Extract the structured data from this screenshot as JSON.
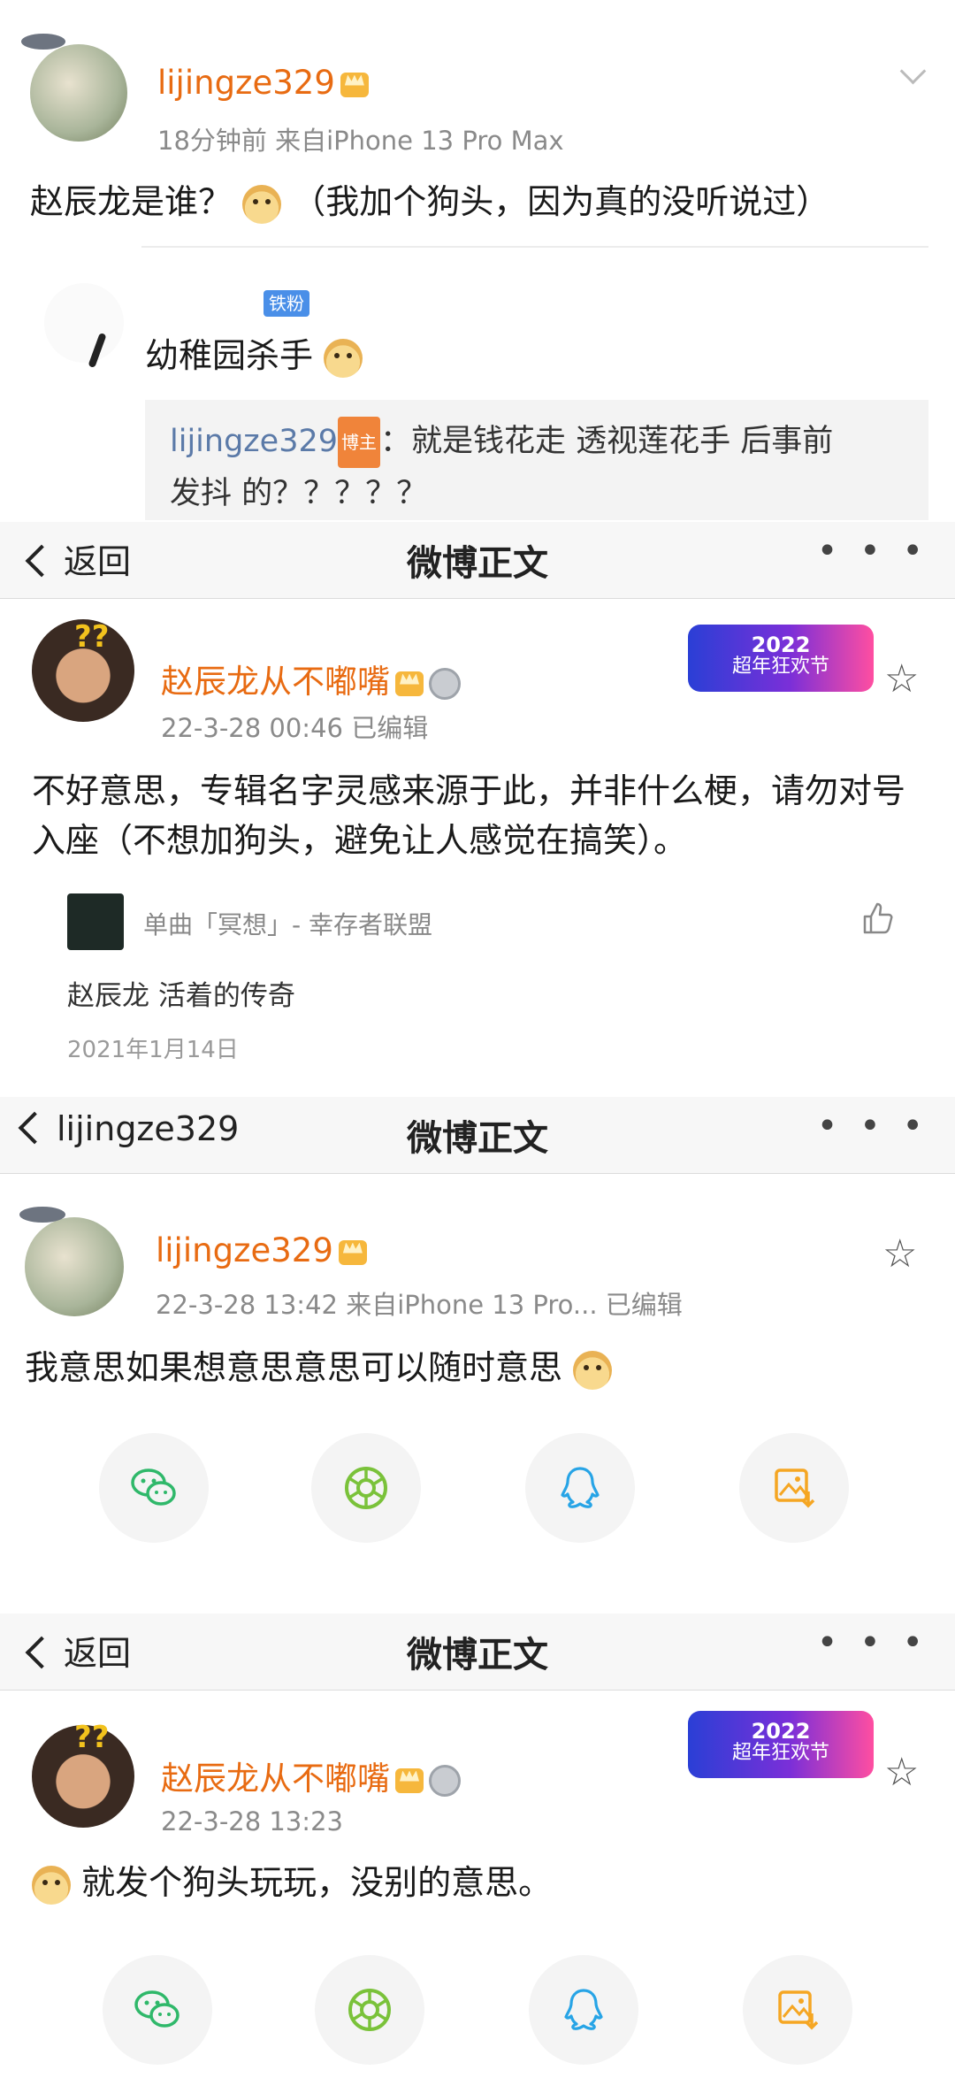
{
  "section1": {
    "username": "lijingze329",
    "meta": "18分钟前  来自iPhone 13 Pro Max",
    "comment": "赵辰龙是谁？",
    "comment_tail": "（我加个狗头，因为真的没听说过）",
    "reply_badge": "铁粉",
    "reply_text": "幼稚园杀手",
    "quote_user": "lijingze329",
    "quote_badge": "博主",
    "quote_line1": "：就是钱花走 透视莲花手 后事前",
    "quote_line2": "发抖 的？？？？？"
  },
  "section2": {
    "back_label": "返回",
    "title": "微博正文",
    "more": "• • •",
    "username": "赵辰龙从不嘟嘴",
    "meta": "22-3-28 00:46   已编辑",
    "badge_year": "2022",
    "badge_text": "超年狂欢节",
    "content": "不好意思，专辑名字灵感来源于此，并非什么梗，请勿对号入座（不想加狗头，避免让人感觉在搞笑）。",
    "music_label": "单曲「冥想」- 幸存者联盟",
    "sub_text": "赵辰龙  活着的传奇",
    "date": "2021年1月14日"
  },
  "section3": {
    "back_label": "lijingze329",
    "title": "微博正文",
    "more": "• • •",
    "username": "lijingze329",
    "meta": "22-3-28 13:42  来自iPhone 13 Pro...  已编辑",
    "content": "我意思如果想意思意思可以随时意思"
  },
  "section4": {
    "back_label": "返回",
    "title": "微博正文",
    "more": "• • •",
    "username": "赵辰龙从不嘟嘴",
    "meta": "22-3-28 13:23",
    "badge_year": "2022",
    "badge_text": "超年狂欢节",
    "content": "就发个狗头玩玩，没别的意思。"
  },
  "icons": {
    "wechat": "wechat-icon",
    "moments": "moments-icon",
    "qq": "qq-icon",
    "save_image": "save-image-icon",
    "star": "star-icon",
    "like": "thumb-up-icon"
  },
  "colors": {
    "username": "#e86b12",
    "link": "#5b7aa8",
    "wechat_green": "#2fb86a",
    "qq_blue": "#27a4e6",
    "save_orange": "#f5a623"
  }
}
